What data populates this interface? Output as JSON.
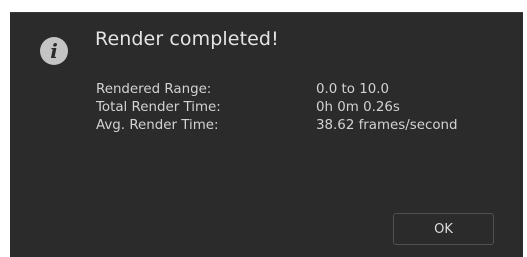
{
  "dialog": {
    "title": "Render completed!",
    "icon": "info-icon",
    "icon_glyph": "i",
    "rows": [
      {
        "label": "Rendered Range:",
        "value": "0.0 to 10.0"
      },
      {
        "label": "Total Render Time:",
        "value": "0h 0m 0.26s"
      },
      {
        "label": "Avg. Render Time:",
        "value": "38.62 frames/second"
      }
    ],
    "ok_label": "OK"
  },
  "colors": {
    "dialog_bg": "#2b2b2b",
    "text_primary": "#e4e4e4",
    "text_secondary": "#d2d2d2",
    "icon_fill": "#c4c4c4",
    "button_border": "#505050"
  }
}
